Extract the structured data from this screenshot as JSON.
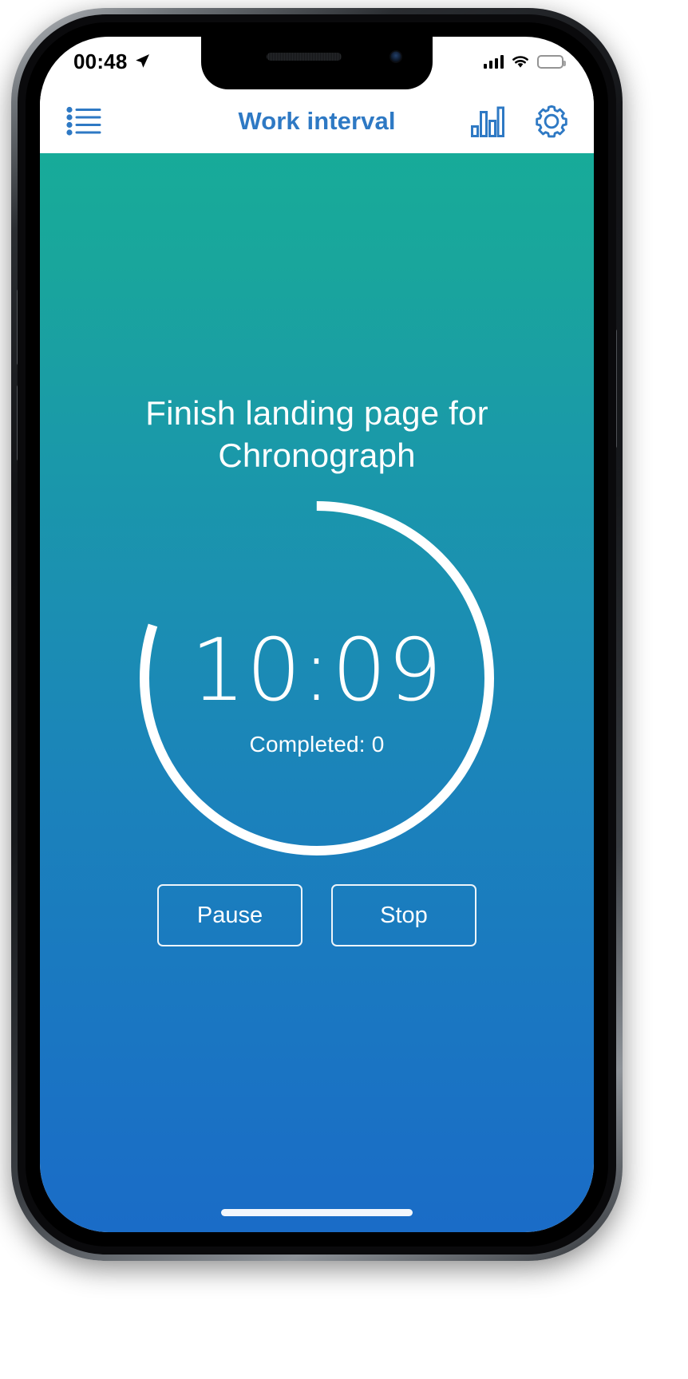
{
  "status_bar": {
    "time": "00:48",
    "location_icon": "location-arrow-icon",
    "signal_icon": "cellular-signal-icon",
    "wifi_icon": "wifi-icon",
    "battery_icon": "battery-icon"
  },
  "navbar": {
    "title": "Work interval",
    "left_icon": "list-icon",
    "stats_icon": "bar-chart-icon",
    "settings_icon": "gear-icon",
    "title_color": "#2e79c4"
  },
  "timer_screen": {
    "task_title": "Finish landing page for Chronograph",
    "time_remaining": "10:09",
    "completed_label": "Completed: 0",
    "completed_count": "0",
    "progress_percent": 80,
    "ring_solid_color": "#ffffff",
    "ring_track_color": "rgba(255,255,255,0.42)",
    "background_top_color": "#17ab99",
    "background_bottom_color": "#1a6cc7"
  },
  "controls": {
    "pause_label": "Pause",
    "stop_label": "Stop"
  },
  "home_indicator": "home-indicator"
}
